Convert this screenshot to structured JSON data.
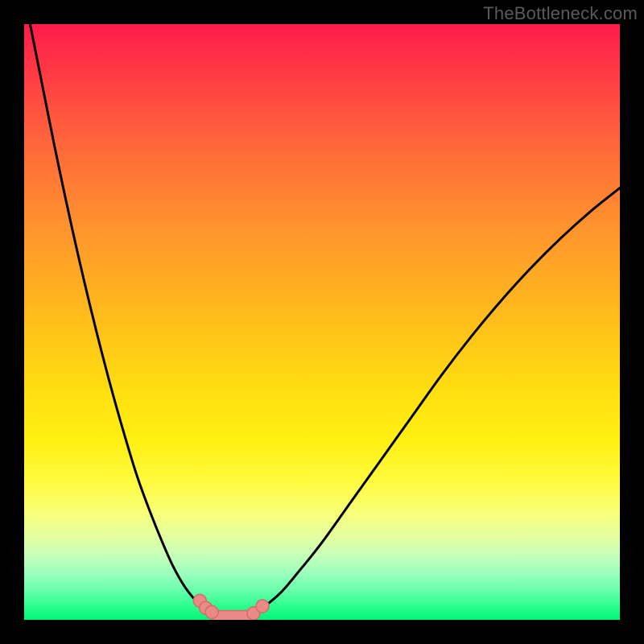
{
  "watermark": "TheBottleneck.com",
  "chart_data": {
    "type": "line",
    "title": "",
    "xlabel": "",
    "ylabel": "",
    "xlim": [
      0,
      100
    ],
    "ylim": [
      0,
      100
    ],
    "grid": false,
    "legend": false,
    "series": [
      {
        "name": "left-curve",
        "x": [
          1,
          3,
          5,
          7,
          9,
          11,
          13,
          15,
          17,
          19,
          21,
          23,
          25,
          27,
          29,
          30.5,
          32
        ],
        "values": [
          100,
          90,
          80,
          70.5,
          61.5,
          53,
          45,
          37.5,
          30.5,
          24,
          18.5,
          13.5,
          9,
          5.5,
          3,
          1.5,
          0.7
        ]
      },
      {
        "name": "right-curve",
        "x": [
          38,
          40,
          43,
          46,
          50,
          55,
          60,
          65,
          70,
          75,
          80,
          85,
          90,
          95,
          100
        ],
        "values": [
          0.7,
          2,
          4.5,
          8,
          13,
          20,
          27,
          34,
          41,
          47.5,
          53.5,
          59,
          64,
          68.5,
          72.5
        ]
      },
      {
        "name": "valley-floor",
        "x": [
          32,
          34,
          36,
          38
        ],
        "values": [
          0.7,
          0.4,
          0.4,
          0.7
        ]
      }
    ],
    "annotations": {
      "valley_markers_left": {
        "x": [
          29.5,
          30.5,
          31.5
        ],
        "y": [
          3.2,
          2.0,
          1.3
        ]
      },
      "valley_markers_right": {
        "x": [
          38.5,
          40.0
        ],
        "y": [
          1.1,
          2.3
        ]
      },
      "valley_bar": {
        "x_start": 31.5,
        "x_end": 38.5,
        "y": 0.6
      }
    },
    "colors": {
      "curve": "#000000",
      "marker_fill": "#e98a88",
      "marker_stroke": "#d86a68",
      "gradient_top": "#ff1b49",
      "gradient_bottom": "#00f578"
    }
  }
}
